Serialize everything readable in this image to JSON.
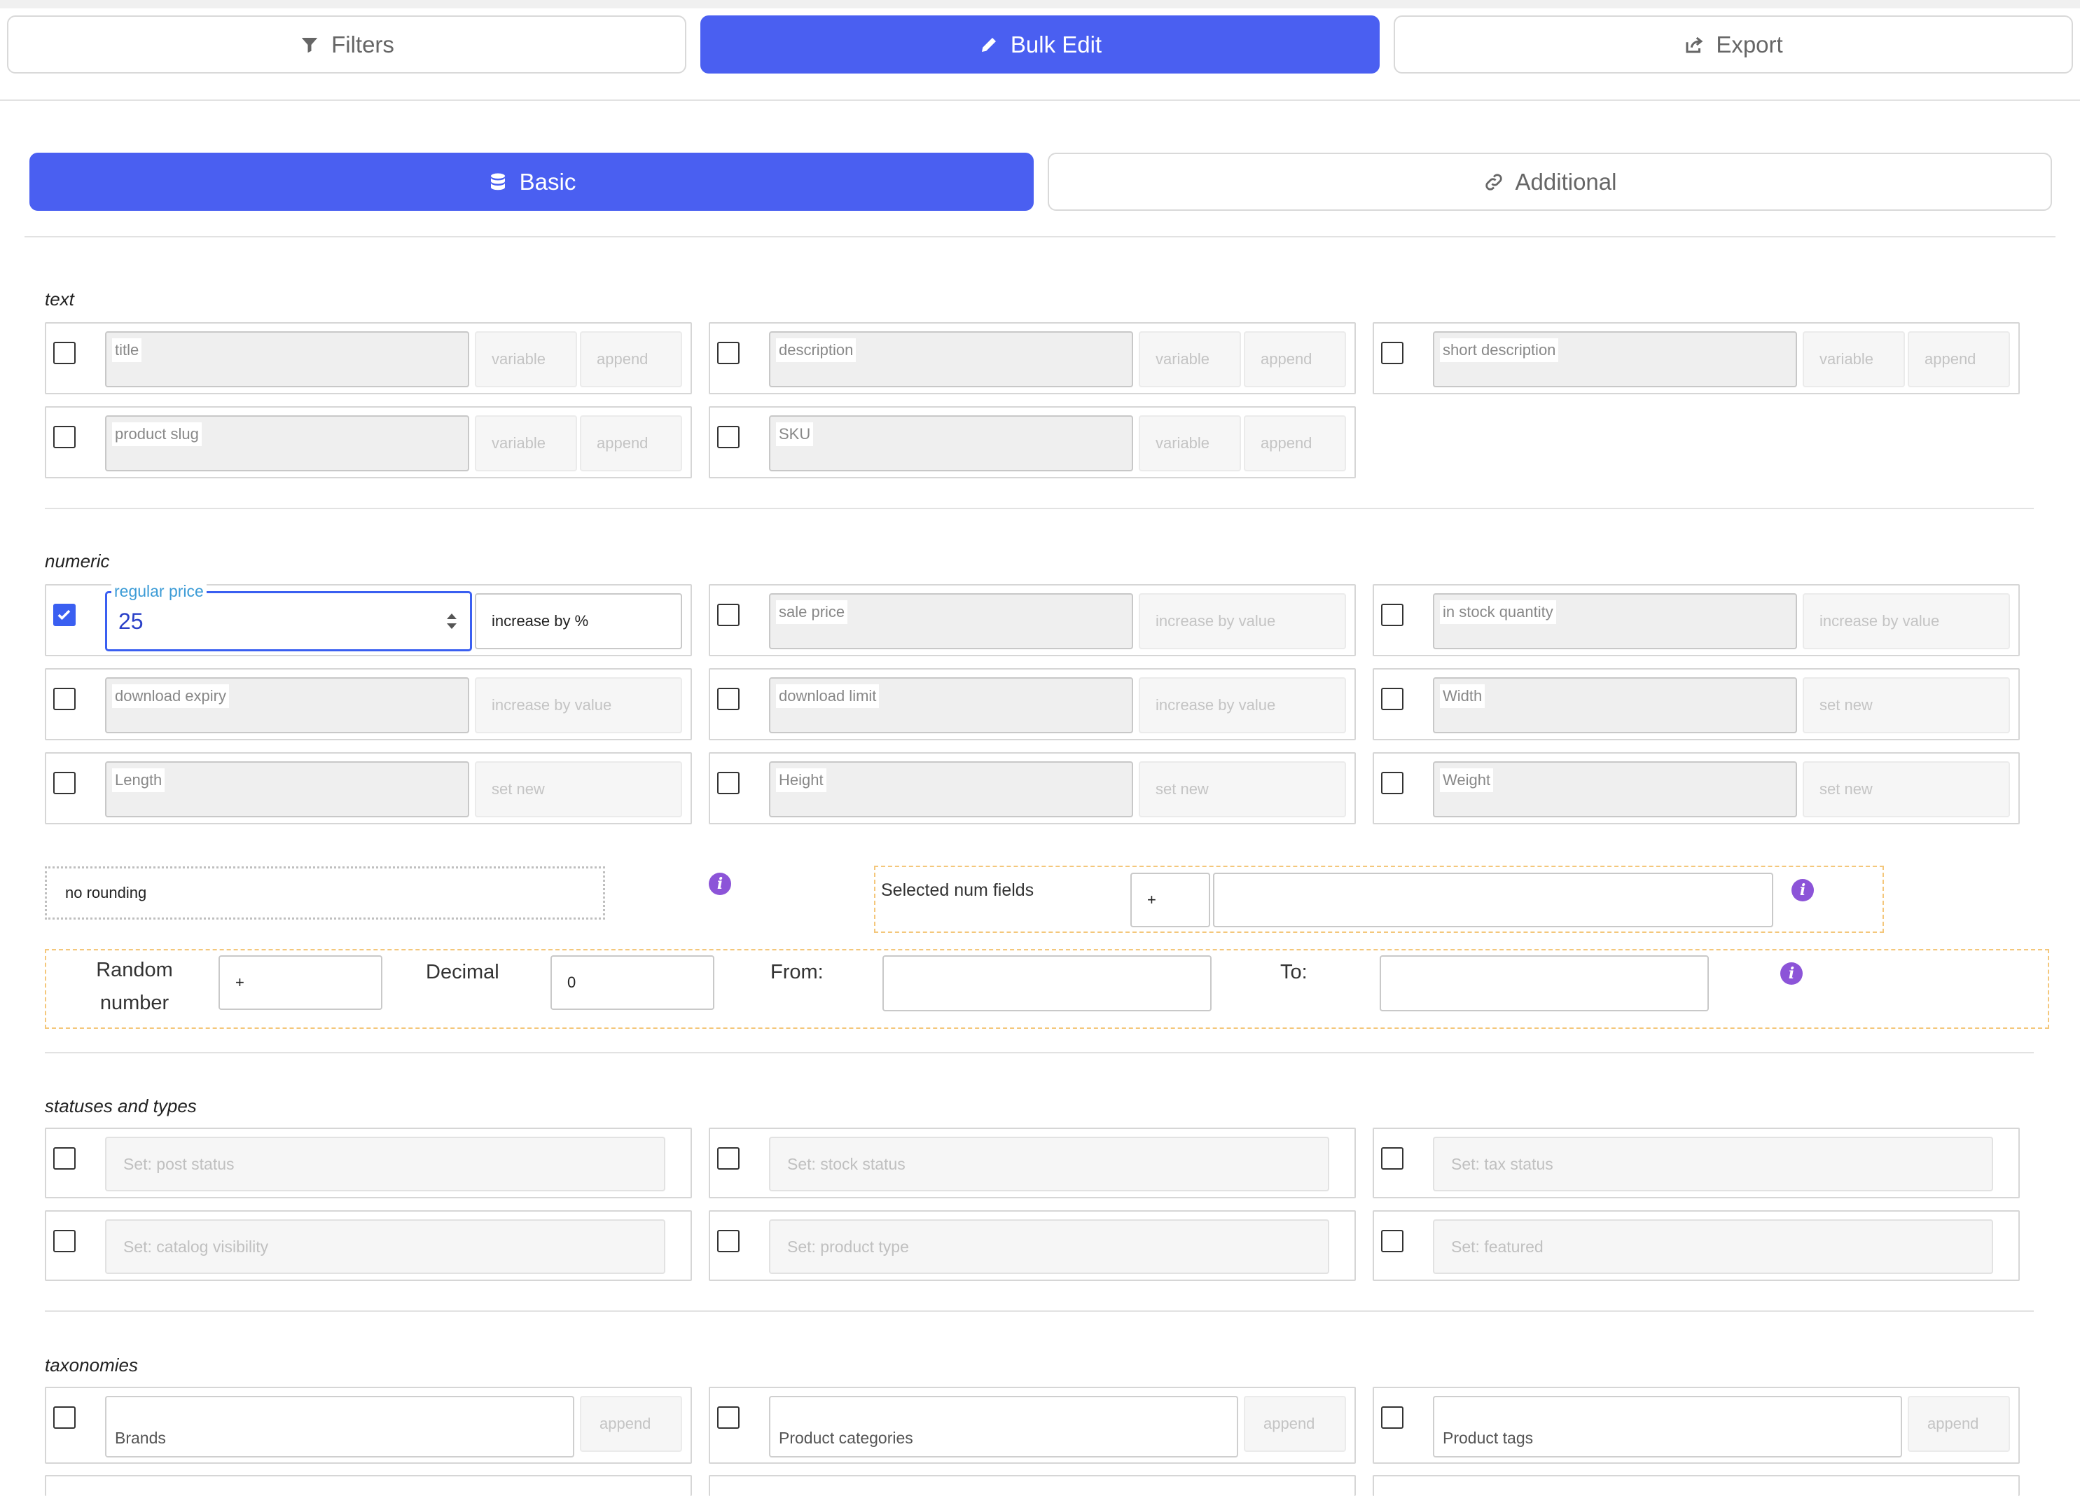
{
  "tabs": {
    "filters": "Filters",
    "bulk_edit": "Bulk Edit",
    "export": "Export"
  },
  "subtabs": {
    "basic": "Basic",
    "additional": "Additional"
  },
  "sections": {
    "text": {
      "title": "text",
      "fields": [
        {
          "label": "title",
          "variable": "variable",
          "append": "append"
        },
        {
          "label": "description",
          "variable": "variable",
          "append": "append"
        },
        {
          "label": "short description",
          "variable": "variable",
          "append": "append"
        },
        {
          "label": "product slug",
          "variable": "variable",
          "append": "append"
        },
        {
          "label": "SKU",
          "variable": "variable",
          "append": "append"
        }
      ]
    },
    "numeric": {
      "title": "numeric",
      "fields": [
        {
          "label": "regular price",
          "value": "25",
          "op": "increase by %",
          "checked": true
        },
        {
          "label": "sale price",
          "op": "increase by value"
        },
        {
          "label": "in stock quantity",
          "op": "increase by value"
        },
        {
          "label": "download expiry",
          "op": "increase by value"
        },
        {
          "label": "download limit",
          "op": "increase by value"
        },
        {
          "label": "Width",
          "op": "set new"
        },
        {
          "label": "Length",
          "op": "set new"
        },
        {
          "label": "Height",
          "op": "set new"
        },
        {
          "label": "Weight",
          "op": "set new"
        }
      ],
      "rounding": "no rounding",
      "selected_num_fields": {
        "label": "Selected num fields",
        "op": "+",
        "value": ""
      },
      "random": {
        "label": "Random number",
        "op": "+",
        "decimal_label": "Decimal",
        "decimal_value": "0",
        "from_label": "From:",
        "to_label": "To:",
        "from": "",
        "to": ""
      },
      "info_icon": "i"
    },
    "statuses": {
      "title": "statuses and types",
      "fields": [
        "Set: post status",
        "Set: stock status",
        "Set: tax status",
        "Set: catalog visibility",
        "Set: product type",
        "Set: featured"
      ]
    },
    "taxonomies": {
      "title": "taxonomies",
      "fields": [
        {
          "label": "Brands",
          "append": "append"
        },
        {
          "label": "Product categories",
          "append": "append"
        },
        {
          "label": "Product tags",
          "append": "append"
        }
      ]
    }
  },
  "colors": {
    "accent": "#4a5ff1",
    "info": "#8c54d8",
    "focus_label": "#3b9bd6",
    "dashed": "#f4c77b"
  },
  "icons": {
    "filters": "funnel-icon",
    "bulk_edit": "pencil-icon",
    "export": "share-export-icon",
    "basic": "database-icon",
    "additional": "link-icon",
    "info": "info-icon"
  }
}
